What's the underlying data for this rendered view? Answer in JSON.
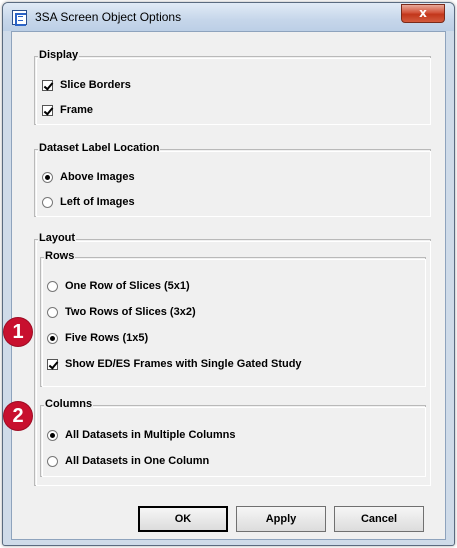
{
  "window": {
    "title": "3SA Screen Object Options",
    "close_label": "x",
    "app_icon": "3sa-app-icon"
  },
  "display": {
    "legend": "Display",
    "slice_borders": {
      "label": "Slice Borders",
      "checked": true
    },
    "frame": {
      "label": "Frame",
      "checked": true
    }
  },
  "dataset_label_location": {
    "legend": "Dataset Label Location",
    "above_images": {
      "label": "Above Images",
      "selected": true
    },
    "left_of_images": {
      "label": "Left of Images",
      "selected": false
    }
  },
  "layout": {
    "legend": "Layout",
    "rows": {
      "legend": "Rows",
      "one_row": {
        "label": "One Row of Slices (5x1)",
        "selected": false
      },
      "two_rows": {
        "label": "Two Rows of Slices (3x2)",
        "selected": false
      },
      "five_rows": {
        "label": "Five Rows (1x5)",
        "selected": true
      },
      "show_ed_es": {
        "label": "Show ED/ES Frames with Single Gated Study",
        "checked": true
      }
    },
    "columns": {
      "legend": "Columns",
      "multiple_columns": {
        "label": "All Datasets in Multiple Columns",
        "selected": true
      },
      "one_column": {
        "label": "All Datasets in One Column",
        "selected": false
      }
    }
  },
  "annotations": {
    "marker_1": "1",
    "marker_2": "2",
    "color": "#c8102e"
  },
  "buttons": {
    "ok": "OK",
    "apply": "Apply",
    "cancel": "Cancel"
  }
}
